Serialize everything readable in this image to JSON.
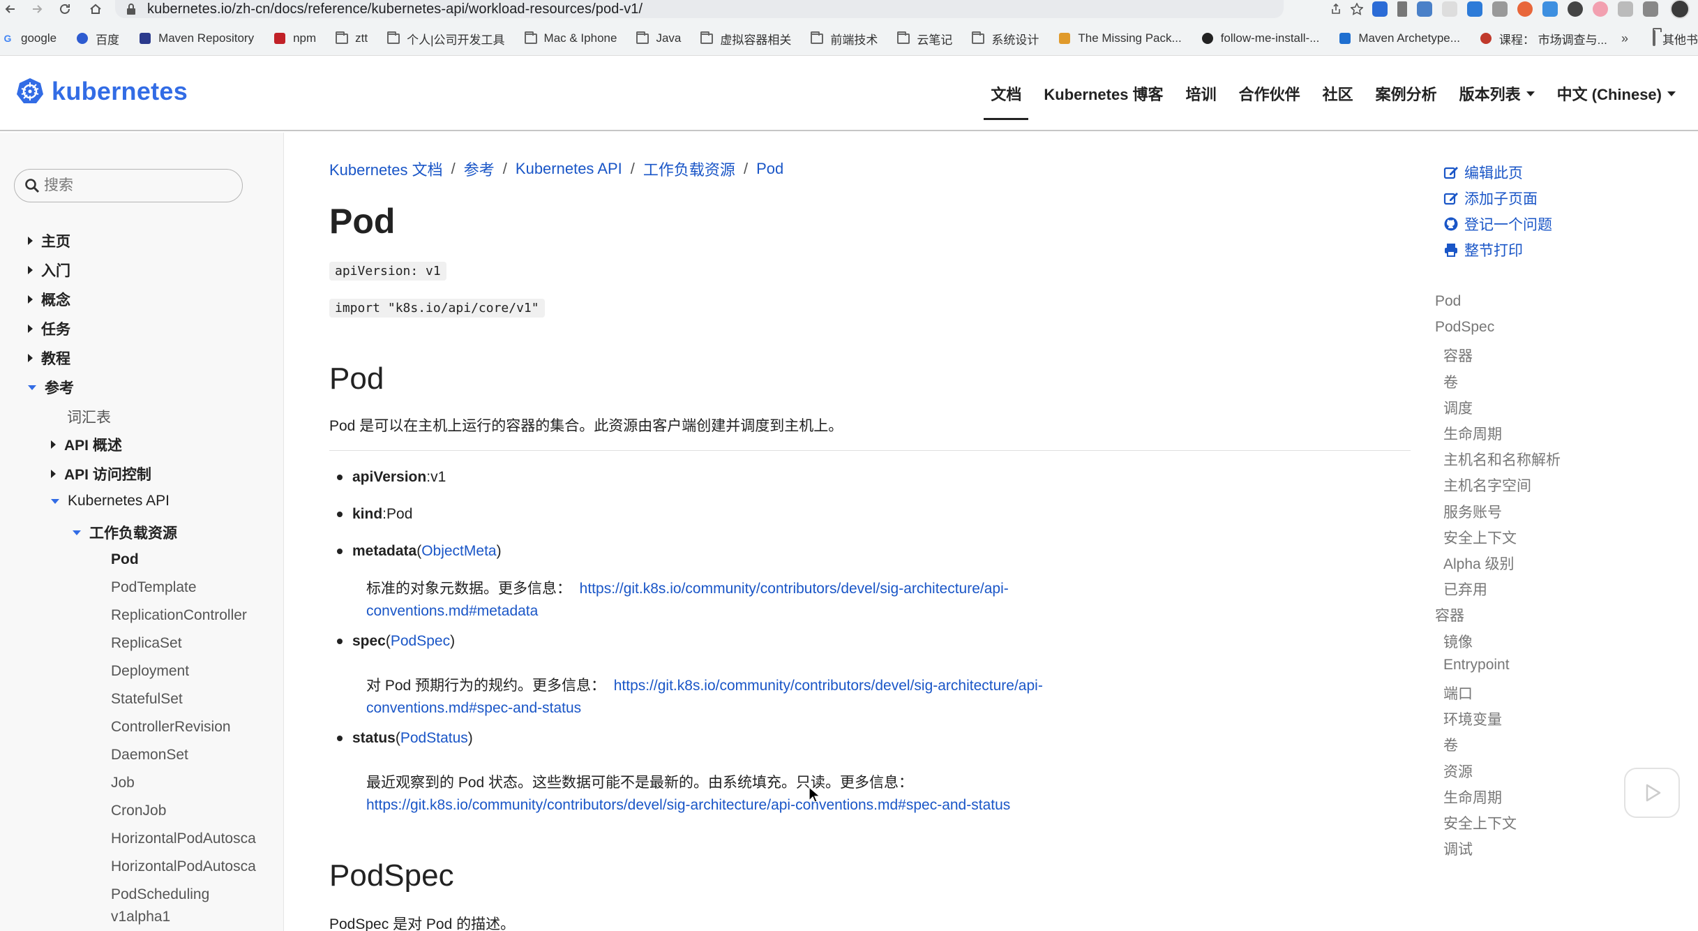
{
  "browser": {
    "url": "kubernetes.io/zh-cn/docs/reference/kubernetes-api/workload-resources/pod-v1/",
    "bookmarks": [
      {
        "label": "google",
        "icon": "google-icon"
      },
      {
        "label": "百度",
        "icon": "baidu-icon"
      },
      {
        "label": "Maven Repository",
        "icon": "mvn-icon"
      },
      {
        "label": "npm",
        "icon": "npm-icon"
      },
      {
        "label": "ztt",
        "icon": "folder-icon"
      },
      {
        "label": "个人|公司开发工具",
        "icon": "folder-icon"
      },
      {
        "label": "Mac & Iphone",
        "icon": "folder-icon"
      },
      {
        "label": "Java",
        "icon": "folder-icon"
      },
      {
        "label": "虚拟容器相关",
        "icon": "folder-icon"
      },
      {
        "label": "前端技术",
        "icon": "folder-icon"
      },
      {
        "label": "云笔记",
        "icon": "folder-icon"
      },
      {
        "label": "系统设计",
        "icon": "folder-icon"
      },
      {
        "label": "The Missing Pack...",
        "icon": "missing-pack-icon"
      },
      {
        "label": "follow-me-install-...",
        "icon": "github-icon"
      },
      {
        "label": "Maven Archetype...",
        "icon": "maven-archetype-icon"
      },
      {
        "label": "课程：  市场调查与...",
        "icon": "course-icon"
      }
    ],
    "more_label": "»",
    "other_bookmarks": "其他书"
  },
  "site": {
    "logo_text": "kubernetes",
    "nav": [
      {
        "label": "文档",
        "active": true
      },
      {
        "label": "Kubernetes 博客"
      },
      {
        "label": "培训"
      },
      {
        "label": "合作伙伴"
      },
      {
        "label": "社区"
      },
      {
        "label": "案例分析"
      },
      {
        "label": "版本列表",
        "dropdown": true
      },
      {
        "label": "中文 (Chinese)",
        "dropdown": true
      }
    ],
    "accent": "#326ce5",
    "link_color": "#1a56c7"
  },
  "sidebar": {
    "search_placeholder": "搜索",
    "items": [
      {
        "label": "主页"
      },
      {
        "label": "入门"
      },
      {
        "label": "概念"
      },
      {
        "label": "任务"
      },
      {
        "label": "教程"
      },
      {
        "label": "参考"
      },
      {
        "label": "词汇表"
      },
      {
        "label": "API 概述"
      },
      {
        "label": "API 访问控制"
      },
      {
        "label": "Kubernetes API"
      },
      {
        "label": "工作负载资源"
      },
      {
        "label": "Pod"
      },
      {
        "label": "PodTemplate"
      },
      {
        "label": "ReplicationController"
      },
      {
        "label": "ReplicaSet"
      },
      {
        "label": "Deployment"
      },
      {
        "label": "StatefulSet"
      },
      {
        "label": "ControllerRevision"
      },
      {
        "label": "DaemonSet"
      },
      {
        "label": "Job"
      },
      {
        "label": "CronJob"
      },
      {
        "label": "HorizontalPodAutosca"
      },
      {
        "label": "HorizontalPodAutosca"
      },
      {
        "label": "PodScheduling"
      },
      {
        "label": "v1alpha1"
      }
    ]
  },
  "main": {
    "breadcrumb": [
      "Kubernetes 文档",
      "参考",
      "Kubernetes API",
      "工作负载资源",
      "Pod"
    ],
    "breadcrumb_sep": "/",
    "title": "Pod",
    "api_version": "apiVersion: v1",
    "import": "import \"k8s.io/api/core/v1\"",
    "section1_title": "Pod",
    "section1_desc": "Pod 是可以在主机上运行的容器的集合。此资源由客户端创建并调度到主机上。",
    "fields": [
      {
        "key": "apiVersion",
        "sep": ": ",
        "value": "v1"
      },
      {
        "key": "kind",
        "sep": ": ",
        "value": "Pod"
      },
      {
        "key": "metadata",
        "open": " (",
        "type": "ObjectMeta",
        "close": ")",
        "desc": "标准的对象元数据。更多信息：",
        "link1": "https://git.k8s.io/community/contributors/devel/sig-architecture/api-",
        "link2": "conventions.md#metadata"
      },
      {
        "key": "spec",
        "open": " (",
        "type": "PodSpec",
        "close": ")",
        "desc": "对 Pod 预期行为的规约。更多信息：",
        "link1": "https://git.k8s.io/community/contributors/devel/sig-architecture/api-",
        "link2": "conventions.md#spec-and-status"
      },
      {
        "key": "status",
        "open": " (",
        "type": "PodStatus",
        "close": ")",
        "desc": "最近观察到的 Pod 状态。这些数据可能不是最新的。由系统填充。只读。更多信息：",
        "link1": "https://git.k8s.io/community/contributors/devel/sig-architecture/api-conventions.md#spec-and-status"
      }
    ],
    "section2_title": "PodSpec",
    "section2_desc": "PodSpec 是对 Pod 的描述。"
  },
  "toc": {
    "actions": [
      {
        "label": "编辑此页",
        "icon": "edit-icon"
      },
      {
        "label": "添加子页面",
        "icon": "edit-icon"
      },
      {
        "label": "登记一个问题",
        "icon": "github-icon"
      },
      {
        "label": "整节打印",
        "icon": "print-icon"
      }
    ],
    "items": [
      {
        "label": "Pod",
        "level": 1
      },
      {
        "label": "PodSpec",
        "level": 1
      },
      {
        "label": "容器",
        "level": 2
      },
      {
        "label": "卷",
        "level": 2
      },
      {
        "label": "调度",
        "level": 2
      },
      {
        "label": "生命周期",
        "level": 2
      },
      {
        "label": "主机名和名称解析",
        "level": 2
      },
      {
        "label": "主机名字空间",
        "level": 2
      },
      {
        "label": "服务账号",
        "level": 2
      },
      {
        "label": "安全上下文",
        "level": 2
      },
      {
        "label": "Alpha 级别",
        "level": 2
      },
      {
        "label": "已弃用",
        "level": 2
      },
      {
        "label": "容器",
        "level": 1
      },
      {
        "label": "镜像",
        "level": 2
      },
      {
        "label": "Entrypoint",
        "level": 2
      },
      {
        "label": "端口",
        "level": 2
      },
      {
        "label": "环境变量",
        "level": 2
      },
      {
        "label": "卷",
        "level": 2
      },
      {
        "label": "资源",
        "level": 2
      },
      {
        "label": "生命周期",
        "level": 2
      },
      {
        "label": "安全上下文",
        "level": 2
      },
      {
        "label": "调试",
        "level": 2
      }
    ]
  }
}
